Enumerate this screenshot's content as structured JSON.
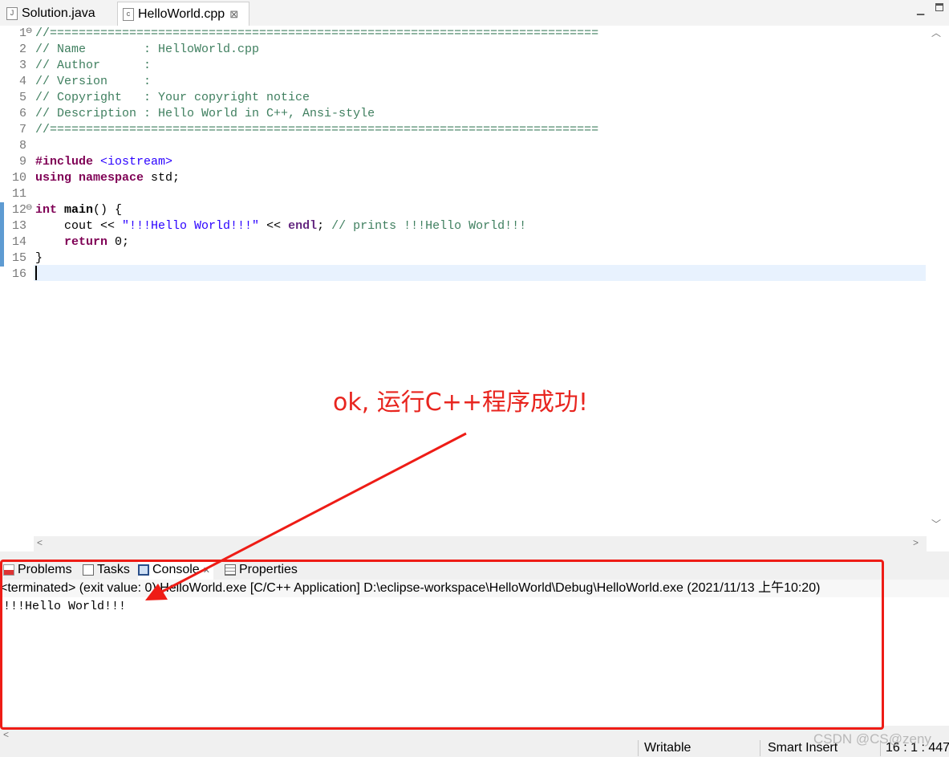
{
  "editor_tabs": [
    {
      "label": "Solution.java",
      "icon": "java-file-icon",
      "icon_glyph": "J"
    },
    {
      "label": "HelloWorld.cpp",
      "icon": "cpp-file-icon",
      "icon_glyph": "c",
      "close": "⊠"
    }
  ],
  "line_numbers": [
    "1",
    "2",
    "3",
    "4",
    "5",
    "6",
    "7",
    "8",
    "9",
    "10",
    "11",
    "12",
    "13",
    "14",
    "15",
    "16"
  ],
  "code": {
    "l1": "//============================================================================",
    "l2": "// Name        : HelloWorld.cpp",
    "l3": "// Author      :",
    "l4": "// Version     :",
    "l5": "// Copyright   : Your copyright notice",
    "l6": "// Description : Hello World in C++, Ansi-style",
    "l7": "//============================================================================",
    "l9_pre": "#include",
    "l9_inc": "<iostream>",
    "l10_kw1": "using",
    "l10_kw2": "namespace",
    "l10_rest": " std;",
    "l12_kw": "int",
    "l12_fn": "main",
    "l12_rest": "() {",
    "l13_a": "    cout << ",
    "l13_str": "\"!!!Hello World!!!\"",
    "l13_b": " << ",
    "l13_endl": "endl",
    "l13_c": "; ",
    "l13_cmt": "// prints !!!Hello World!!!",
    "l14_kw": "return",
    "l14_rest": " 0;",
    "l15": "}"
  },
  "annotation": "ok, 运行C++程序成功!",
  "panel_tabs": [
    {
      "label": "Problems",
      "icon": "problems-icon"
    },
    {
      "label": "Tasks",
      "icon": "tasks-icon"
    },
    {
      "label": "Console",
      "icon": "console-icon",
      "close": "✕"
    },
    {
      "label": "Properties",
      "icon": "properties-icon"
    }
  ],
  "console": {
    "description": "<terminated> (exit value: 0) HelloWorld.exe [C/C++ Application] D:\\eclipse-workspace\\HelloWorld\\Debug\\HelloWorld.exe (2021/11/13 上午10:20)",
    "output": "!!!Hello World!!!"
  },
  "status": {
    "writable": "Writable",
    "insert_mode": "Smart Insert",
    "position": "16 : 1 : 447"
  },
  "watermark": "CSDN @CS@zeny",
  "colors": {
    "annotation_red": "#e8251f",
    "comment": "#3f7f5f",
    "keyword": "#7f0055",
    "string": "#2a00ff"
  }
}
